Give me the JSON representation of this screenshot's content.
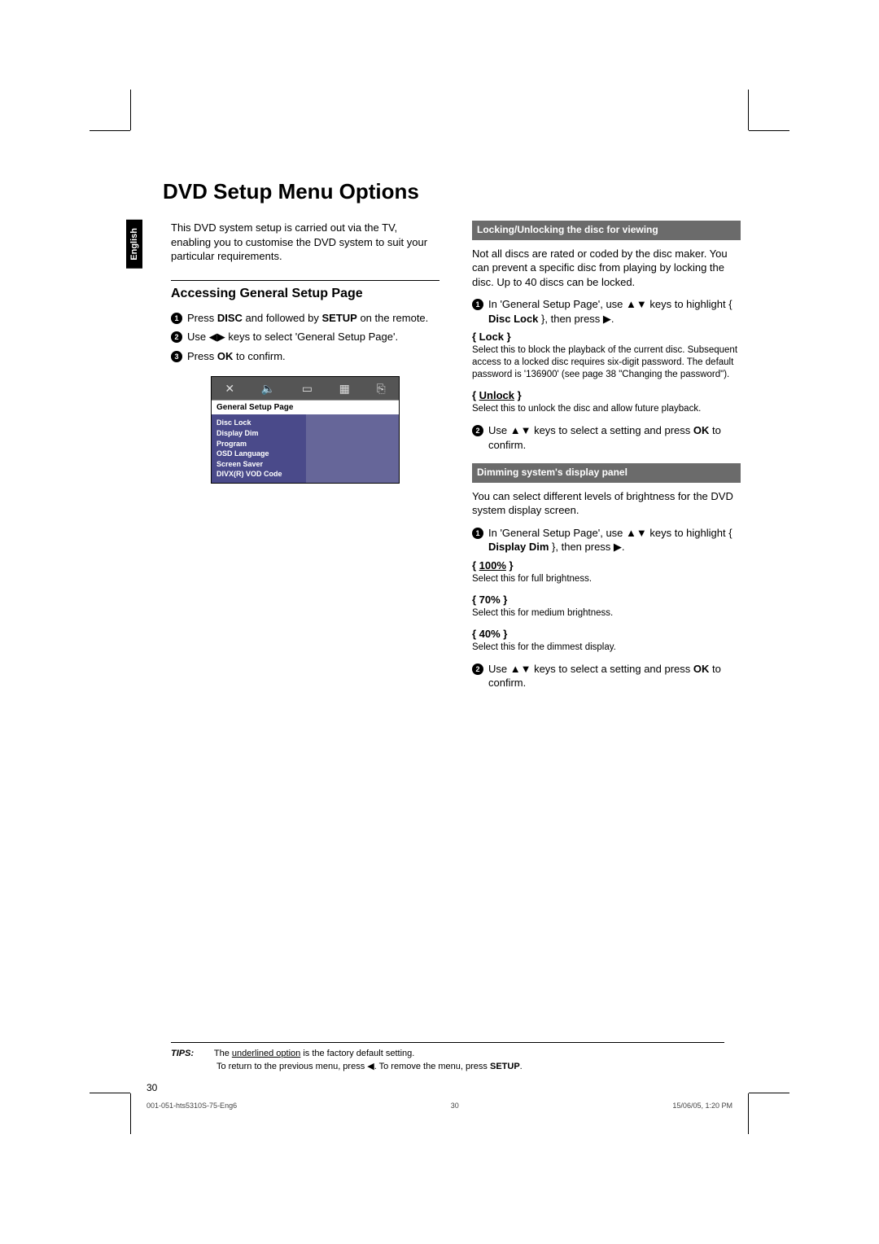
{
  "lang_tab": "English",
  "title": "DVD Setup Menu Options",
  "intro": "This DVD system setup is carried out via the TV, enabling you to customise the DVD system to suit your particular requirements.",
  "left": {
    "subhead": "Accessing General Setup Page",
    "step1": "Press DISC and followed by SETUP on the remote.",
    "step2": "Use ◀▶ keys to select 'General Setup Page'.",
    "step3": "Press OK to confirm.",
    "menu_header": "General Setup Page",
    "menu_items": [
      "Disc Lock",
      "Display Dim",
      "Program",
      "OSD Language",
      "Screen Saver",
      "DIVX(R) VOD Code"
    ]
  },
  "right": {
    "sec1_title": "Locking/Unlocking the disc for viewing",
    "sec1_para": "Not all discs are rated or coded by the disc maker.  You can prevent a specific disc from playing by locking the disc.  Up to 40 discs can be locked.",
    "sec1_step1": "In 'General Setup Page', use ▲▼ keys to highlight { Disc Lock }, then press ▶.",
    "lock_label": "{ Lock }",
    "lock_desc": "Select this to block the playback of the current disc.  Subsequent access to a locked disc requires six-digit password.  The default password is '136900' (see page 38 \"Changing the password\").",
    "unlock_label": "{ Unlock }",
    "unlock_desc": "Select this to unlock the disc and allow future playback.",
    "sec1_step2": "Use ▲▼ keys to select a setting and press OK to confirm.",
    "sec2_title": "Dimming system's display panel",
    "sec2_para": "You can select different levels of brightness for the DVD system display screen.",
    "sec2_step1": "In 'General Setup Page', use ▲▼ keys to highlight { Display Dim }, then press ▶.",
    "p100_label": "{ 100% }",
    "p100_desc": "Select this for full brightness.",
    "p70_label": "{ 70% }",
    "p70_desc": "Select this for medium brightness.",
    "p40_label": "{ 40% }",
    "p40_desc": "Select this for the dimmest display.",
    "sec2_step2": "Use ▲▼ keys to select a setting and press OK to confirm."
  },
  "tips": {
    "label": "TIPS:",
    "line1a": "The ",
    "line1b": "underlined option",
    "line1c": " is the factory default setting.",
    "line2": "To return to the previous menu, press ◀.  To remove the menu, press SETUP."
  },
  "page_num": "30",
  "footer": {
    "left": "001-051-hts5310S-75-Eng6",
    "center": "30",
    "right": "15/06/05, 1:20 PM"
  }
}
